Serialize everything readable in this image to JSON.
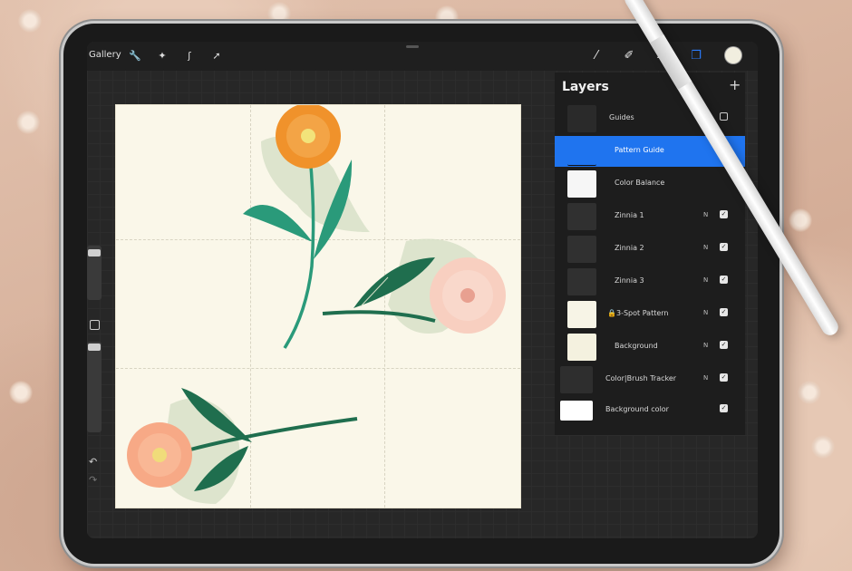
{
  "topbar": {
    "gallery_label": "Gallery",
    "left_icons": [
      "wrench-icon",
      "wand-icon",
      "s-curve-icon",
      "arrow-cursor-icon"
    ],
    "right_icons": [
      "brush-icon",
      "smudge-icon",
      "eraser-icon",
      "layers-icon"
    ],
    "active_color": "#f1eedf",
    "accent_color": "#2a7cff"
  },
  "layers": {
    "title": "Layers",
    "add_symbol": "+",
    "items": [
      {
        "name": "Guides",
        "mode": "",
        "visible": true,
        "type": "group"
      },
      {
        "name": "Pattern Guide",
        "mode": "",
        "visible": true,
        "selected": true
      },
      {
        "name": "Color Balance",
        "mode": "",
        "visible": false
      },
      {
        "name": "Zinnia 1",
        "mode": "N",
        "visible": true
      },
      {
        "name": "Zinnia 2",
        "mode": "N",
        "visible": true
      },
      {
        "name": "Zinnia 3",
        "mode": "N",
        "visible": true
      },
      {
        "name": "3-Spot Pattern",
        "mode": "N",
        "visible": true,
        "locked": true
      },
      {
        "name": "Background",
        "mode": "N",
        "visible": true
      },
      {
        "name": "Color|Brush Tracker",
        "mode": "N",
        "visible": true
      },
      {
        "name": "Background color",
        "mode": "",
        "visible": true
      }
    ]
  },
  "canvas": {
    "background_color": "#faf7e9",
    "flower_colors": {
      "orange": "#f0922b",
      "peach": "#f7a986",
      "pink": "#f8cfc0",
      "leaf": "#2a9a7a",
      "dark_leaf": "#1f6e4e"
    }
  }
}
